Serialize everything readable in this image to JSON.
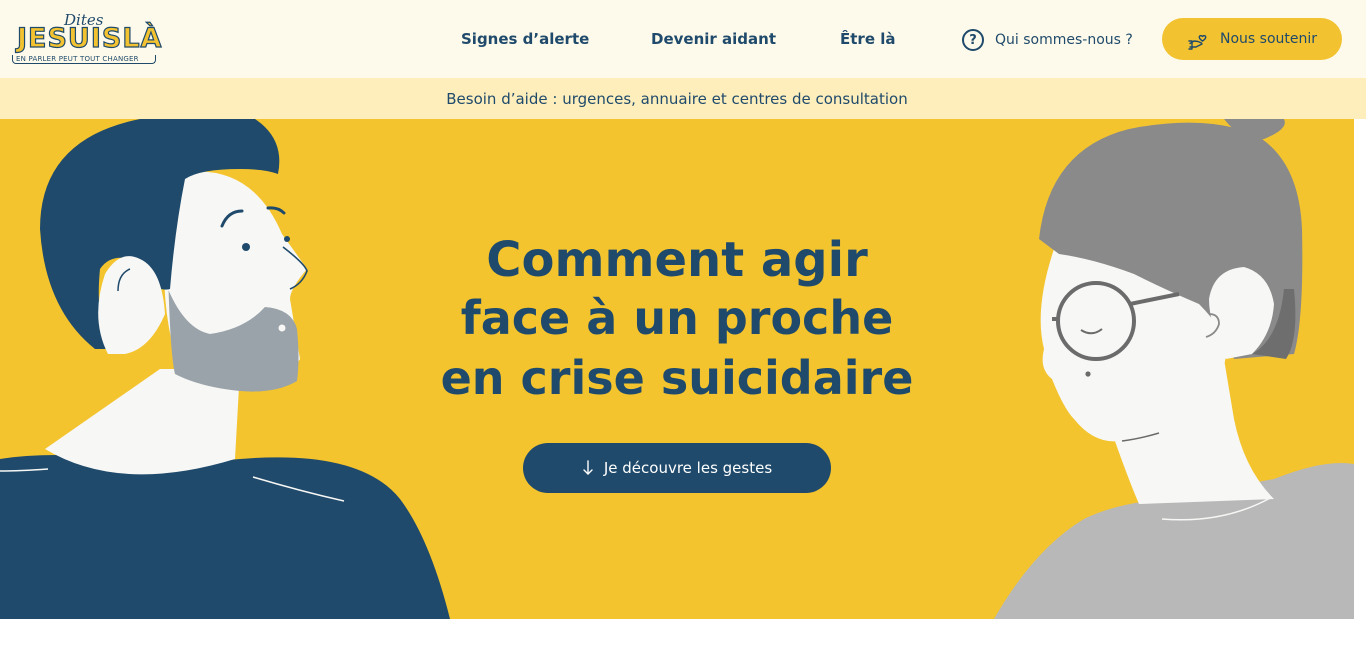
{
  "header": {
    "logo": {
      "script_text": "Dites",
      "main_text": "JESUISLÀ",
      "tagline": "EN PARLER PEUT TOUT CHANGER"
    },
    "nav": [
      {
        "label": "Signes d’alerte"
      },
      {
        "label": "Devenir aidant"
      },
      {
        "label": "Être là"
      }
    ],
    "about": {
      "label": "Qui sommes-nous ?",
      "icon": "question-circle-icon"
    },
    "support": {
      "label": "Nous soutenir",
      "icon": "hand-heart-icon"
    }
  },
  "help_bar": {
    "label": "Besoin d’aide : urgences, annuaire et centres de consultation"
  },
  "hero": {
    "title_strong": "Comment agir",
    "title_line2": "face à un proche",
    "title_line3": "en crise suicidaire",
    "cta": {
      "label": "Je découvre les gestes",
      "icon": "arrow-down-icon"
    }
  },
  "colors": {
    "navy": "#1f4a6b",
    "yellow": "#f4c42f",
    "cream": "#fefaeb",
    "help_bar": "#fdeebc",
    "grey_hair": "#8a8a8a",
    "grey_shirt": "#b8b8b8"
  }
}
